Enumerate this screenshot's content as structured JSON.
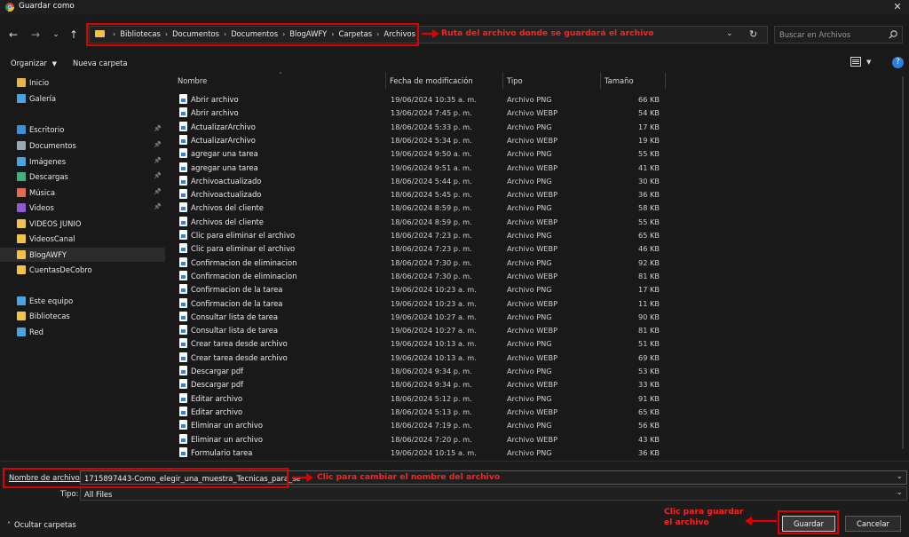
{
  "window": {
    "title": "Guardar como"
  },
  "breadcrumb": {
    "items": [
      "Bibliotecas",
      "Documentos",
      "Documentos",
      "BlogAWFY",
      "Carpetas",
      "Archivos"
    ]
  },
  "search": {
    "placeholder": "Buscar en Archivos"
  },
  "toolbar": {
    "organize_label": "Organizar",
    "new_folder_label": "Nueva carpeta"
  },
  "sidebar": {
    "items": [
      {
        "label": "Inicio",
        "icon": "home-icon",
        "color": "#e6b34a"
      },
      {
        "label": "Galería",
        "icon": "gallery-icon",
        "color": "#4aa3df"
      },
      {
        "label": "Escritorio",
        "icon": "desktop-icon",
        "color": "#3d8fd6",
        "pinned": true
      },
      {
        "label": "Documentos",
        "icon": "documents-icon",
        "color": "#9aa6b2",
        "pinned": true
      },
      {
        "label": "Imágenes",
        "icon": "images-icon",
        "color": "#4aa3df",
        "pinned": true
      },
      {
        "label": "Descargas",
        "icon": "downloads-icon",
        "color": "#3fb27f",
        "pinned": true
      },
      {
        "label": "Música",
        "icon": "music-icon",
        "color": "#e46a54",
        "pinned": true
      },
      {
        "label": "Videos",
        "icon": "videos-icon",
        "color": "#8e5ad8",
        "pinned": true
      },
      {
        "label": "VIDEOS JUNIO",
        "icon": "folder-icon",
        "color": "#f0c248"
      },
      {
        "label": "VideosCanal",
        "icon": "folder-icon",
        "color": "#f0c248"
      },
      {
        "label": "BlogAWFY",
        "icon": "folder-icon",
        "color": "#f0c248",
        "selected": true
      },
      {
        "label": "CuentasDeCobro",
        "icon": "folder-icon",
        "color": "#f0c248"
      },
      {
        "label": "Este equipo",
        "icon": "computer-icon",
        "color": "#4aa3df"
      },
      {
        "label": "Bibliotecas",
        "icon": "libraries-icon",
        "color": "#f0c248"
      },
      {
        "label": "Red",
        "icon": "network-icon",
        "color": "#4aa3df"
      }
    ]
  },
  "columns": {
    "name": "Nombre",
    "date": "Fecha de modificación",
    "type": "Tipo",
    "size": "Tamaño"
  },
  "files": [
    {
      "name": "Abrir archivo",
      "date": "19/06/2024 10:35 a. m.",
      "type": "Archivo PNG",
      "size": "66 KB"
    },
    {
      "name": "Abrir archivo",
      "date": "13/06/2024 7:45 p. m.",
      "type": "Archivo WEBP",
      "size": "54 KB"
    },
    {
      "name": "ActualizarArchivo",
      "date": "18/06/2024 5:33 p. m.",
      "type": "Archivo PNG",
      "size": "17 KB"
    },
    {
      "name": "ActualizarArchivo",
      "date": "18/06/2024 5:34 p. m.",
      "type": "Archivo WEBP",
      "size": "19 KB"
    },
    {
      "name": "agregar una tarea",
      "date": "19/06/2024 9:50 a. m.",
      "type": "Archivo PNG",
      "size": "55 KB"
    },
    {
      "name": "agregar una tarea",
      "date": "19/06/2024 9:51 a. m.",
      "type": "Archivo WEBP",
      "size": "41 KB"
    },
    {
      "name": "Archivoactualizado",
      "date": "18/06/2024 5:44 p. m.",
      "type": "Archivo PNG",
      "size": "30 KB"
    },
    {
      "name": "Archivoactualizado",
      "date": "18/06/2024 5:45 p. m.",
      "type": "Archivo WEBP",
      "size": "36 KB"
    },
    {
      "name": "Archivos del cliente",
      "date": "18/06/2024 8:59 p. m.",
      "type": "Archivo PNG",
      "size": "58 KB"
    },
    {
      "name": "Archivos del cliente",
      "date": "18/06/2024 8:59 p. m.",
      "type": "Archivo WEBP",
      "size": "55 KB"
    },
    {
      "name": "Clic para eliminar el archivo",
      "date": "18/06/2024 7:23 p. m.",
      "type": "Archivo PNG",
      "size": "65 KB"
    },
    {
      "name": "Clic para eliminar el archivo",
      "date": "18/06/2024 7:23 p. m.",
      "type": "Archivo WEBP",
      "size": "46 KB"
    },
    {
      "name": "Confirmacion de eliminacion",
      "date": "18/06/2024 7:30 p. m.",
      "type": "Archivo PNG",
      "size": "92 KB"
    },
    {
      "name": "Confirmacion de eliminacion",
      "date": "18/06/2024 7:30 p. m.",
      "type": "Archivo WEBP",
      "size": "81 KB"
    },
    {
      "name": "Confirmacion de la tarea",
      "date": "19/06/2024 10:23 a. m.",
      "type": "Archivo PNG",
      "size": "17 KB"
    },
    {
      "name": "Confirmacion de la tarea",
      "date": "19/06/2024 10:23 a. m.",
      "type": "Archivo WEBP",
      "size": "11 KB"
    },
    {
      "name": "Consultar lista de tarea",
      "date": "19/06/2024 10:27 a. m.",
      "type": "Archivo PNG",
      "size": "90 KB"
    },
    {
      "name": "Consultar lista de tarea",
      "date": "19/06/2024 10:27 a. m.",
      "type": "Archivo WEBP",
      "size": "81 KB"
    },
    {
      "name": "Crear tarea desde archivo",
      "date": "19/06/2024 10:13 a. m.",
      "type": "Archivo PNG",
      "size": "51 KB"
    },
    {
      "name": "Crear tarea desde archivo",
      "date": "19/06/2024 10:13 a. m.",
      "type": "Archivo WEBP",
      "size": "69 KB"
    },
    {
      "name": "Descargar pdf",
      "date": "18/06/2024 9:34 p. m.",
      "type": "Archivo PNG",
      "size": "53 KB"
    },
    {
      "name": "Descargar pdf",
      "date": "18/06/2024 9:34 p. m.",
      "type": "Archivo WEBP",
      "size": "33 KB"
    },
    {
      "name": "Editar archivo",
      "date": "18/06/2024 5:12 p. m.",
      "type": "Archivo PNG",
      "size": "91 KB"
    },
    {
      "name": "Editar archivo",
      "date": "18/06/2024 5:13 p. m.",
      "type": "Archivo WEBP",
      "size": "65 KB"
    },
    {
      "name": "Eliminar un archivo",
      "date": "18/06/2024 7:19 p. m.",
      "type": "Archivo PNG",
      "size": "56 KB"
    },
    {
      "name": "Eliminar un archivo",
      "date": "18/06/2024 7:20 p. m.",
      "type": "Archivo WEBP",
      "size": "43 KB"
    },
    {
      "name": "Formulario tarea",
      "date": "19/06/2024 10:15 a. m.",
      "type": "Archivo PNG",
      "size": "36 KB"
    }
  ],
  "footer": {
    "filename_label": "Nombre de archivo:",
    "filename_value": "1715897443-Como_elegir_una_muestra_Tecnicas_para_se",
    "type_label": "Tipo:",
    "type_value": "All Files",
    "hide_folders_label": "Ocultar carpetas",
    "save_label": "Guardar",
    "cancel_label": "Cancelar"
  },
  "annotations": {
    "path_note": "Ruta del archivo donde se guardará el archivo",
    "rename_note": "Clic para cambiar el nombre del archivo",
    "save_note_line1": "Clic para guardar",
    "save_note_line2": "el archivo",
    "color": "#e00000"
  }
}
